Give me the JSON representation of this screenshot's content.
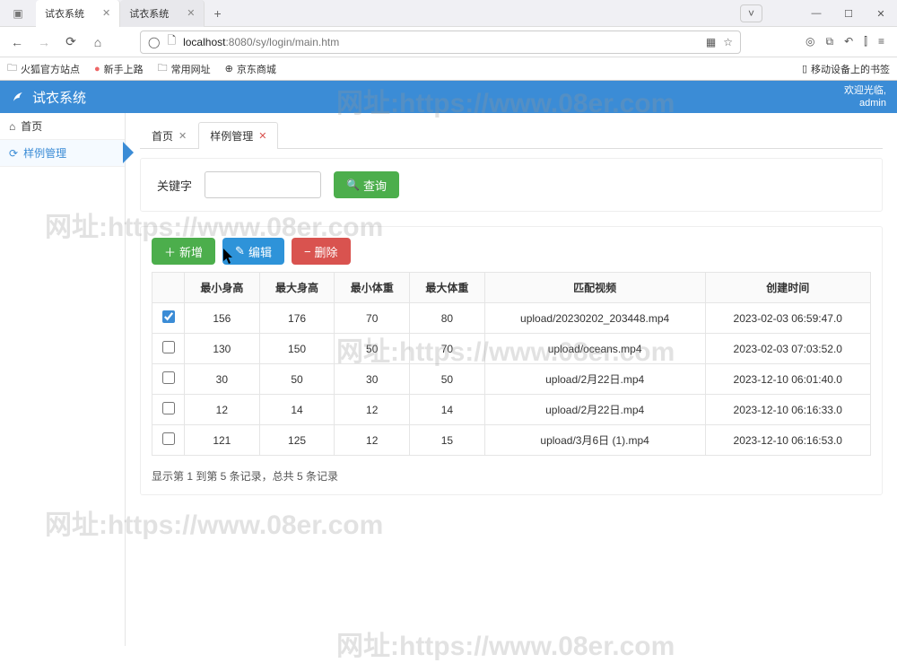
{
  "browser": {
    "tabs": [
      {
        "title": "试衣系统"
      },
      {
        "title": "试衣系统"
      }
    ],
    "url_domain": "localhost",
    "url_port": ":8080",
    "url_path": "/sy/login/main.htm",
    "bookmarks": [
      {
        "label": "火狐官方站点"
      },
      {
        "label": "新手上路"
      },
      {
        "label": "常用网址"
      },
      {
        "label": "京东商城"
      }
    ],
    "bookmarks_right": "移动设备上的书签",
    "window_dropdown": "˅"
  },
  "app": {
    "title": "试衣系统",
    "welcome_line1": "欢迎光临,",
    "welcome_line2": "admin"
  },
  "sidebar": {
    "home": "首页",
    "sample_mgmt": "样例管理"
  },
  "tabs": {
    "home": "首页",
    "sample_mgmt": "样例管理"
  },
  "search": {
    "label": "关键字",
    "query_btn": "查询"
  },
  "actions": {
    "add": "新增",
    "edit": "编辑",
    "delete": "删除"
  },
  "table": {
    "cols": {
      "min_h": "最小身高",
      "max_h": "最大身高",
      "min_w": "最小体重",
      "max_w": "最大体重",
      "video": "匹配视频",
      "created": "创建时间"
    },
    "rows": [
      {
        "checked": true,
        "min_h": "156",
        "max_h": "176",
        "min_w": "70",
        "max_w": "80",
        "video": "upload/20230202_203448.mp4",
        "created": "2023-02-03 06:59:47.0"
      },
      {
        "checked": false,
        "min_h": "130",
        "max_h": "150",
        "min_w": "50",
        "max_w": "70",
        "video": "upload/oceans.mp4",
        "created": "2023-02-03 07:03:52.0"
      },
      {
        "checked": false,
        "min_h": "30",
        "max_h": "50",
        "min_w": "30",
        "max_w": "50",
        "video": "upload/2月22日.mp4",
        "created": "2023-12-10 06:01:40.0"
      },
      {
        "checked": false,
        "min_h": "12",
        "max_h": "14",
        "min_w": "12",
        "max_w": "14",
        "video": "upload/2月22日.mp4",
        "created": "2023-12-10 06:16:33.0"
      },
      {
        "checked": false,
        "min_h": "121",
        "max_h": "125",
        "min_w": "12",
        "max_w": "15",
        "video": "upload/3月6日 (1).mp4",
        "created": "2023-12-10 06:16:53.0"
      }
    ]
  },
  "pagination": "显示第 1 到第 5 条记录，总共 5 条记录",
  "watermark": "网址:https://www.08er.com"
}
